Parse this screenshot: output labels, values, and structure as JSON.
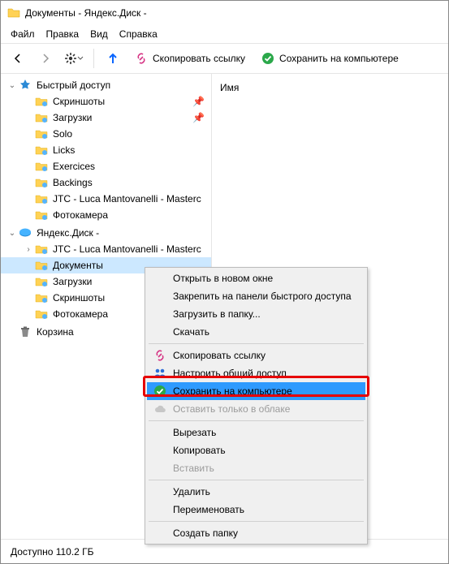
{
  "window": {
    "title": "Документы - Яндекс.Диск -"
  },
  "menu": {
    "file": "Файл",
    "edit": "Правка",
    "view": "Вид",
    "help": "Справка"
  },
  "toolbar": {
    "copy_link": "Скопировать ссылку",
    "save_local": "Сохранить на компьютере"
  },
  "columns": {
    "name": "Имя"
  },
  "tree": {
    "quick_access": "Быстрый доступ",
    "items_qa": [
      "Скриншоты",
      "Загрузки",
      "Solo",
      "Licks",
      "Exercices",
      "Backings",
      "JTC - Luca Mantovanelli - Masterc",
      "Фотокамера"
    ],
    "yadisk": "Яндекс.Диск -",
    "items_yd": [
      "JTC - Luca Mantovanelli - Masterc",
      "Документы",
      "Загрузки",
      "Скриншоты",
      "Фотокамера"
    ],
    "trash": "Корзина"
  },
  "context": {
    "open_new_window": "Открыть в новом окне",
    "pin_quick_access": "Закрепить на панели быстрого доступа",
    "upload_to_folder": "Загрузить в папку...",
    "download": "Скачать",
    "copy_link": "Скопировать ссылку",
    "configure_sharing": "Настроить общий доступ",
    "save_local": "Сохранить на компьютере",
    "keep_cloud_only": "Оставить только в облаке",
    "cut": "Вырезать",
    "copy": "Копировать",
    "paste": "Вставить",
    "delete": "Удалить",
    "rename": "Переименовать",
    "create_folder": "Создать папку"
  },
  "status": {
    "available": "Доступно 110.2 ГБ"
  },
  "colors": {
    "selection": "#cce8ff",
    "highlight_red": "#e60000",
    "link_icon": "#d63384",
    "check_green": "#2ba84a",
    "upload_blue": "#0a66ff"
  }
}
